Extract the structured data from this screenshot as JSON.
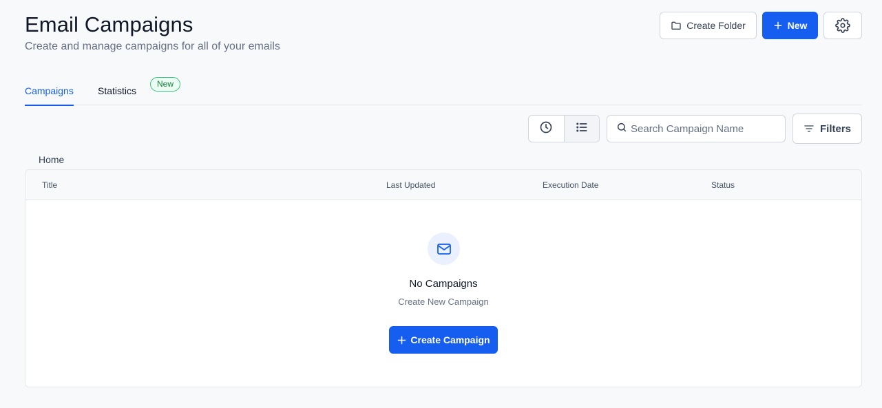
{
  "header": {
    "title": "Email Campaigns",
    "subtitle": "Create and manage campaigns for all of your emails",
    "create_folder_label": "Create Folder",
    "new_label": "New"
  },
  "tabs": [
    {
      "label": "Campaigns",
      "active": true
    },
    {
      "label": "Statistics",
      "active": false,
      "badge": "New"
    }
  ],
  "toolbar": {
    "search_placeholder": "Search Campaign Name",
    "filters_label": "Filters"
  },
  "breadcrumb": "Home",
  "table": {
    "columns": [
      "Title",
      "Last Updated",
      "Execution Date",
      "Status"
    ]
  },
  "empty_state": {
    "icon": "mail-icon",
    "title": "No Campaigns",
    "subtitle": "Create New Campaign",
    "button_label": "Create Campaign"
  },
  "colors": {
    "primary": "#155eef",
    "badge_green": "#34c17a",
    "background": "#f8f9fb"
  }
}
